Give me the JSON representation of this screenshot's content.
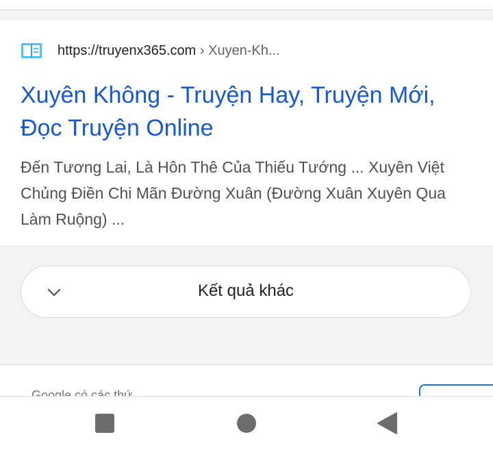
{
  "result": {
    "favicon_icon": "open-book-icon",
    "url_host": "https://truyenx365.com",
    "url_separator": " › ",
    "url_path": "Xuyen-Kh...",
    "title": "Xuyên Không - Truyện Hay, Truyện Mới, Đọc Truyện Online",
    "snippet": "Đến Tương Lai, Là Hôn Thê Của Thiếu Tướng ... Xuyên Việt Chủng Điền Chi Mãn Đường Xuân (Đường Xuân Xuyên Qua Làm Ruộng) ..."
  },
  "more_results": {
    "label": "Kết quả khác",
    "icon": "chevron-down-icon"
  },
  "footer": {
    "partial_text": "Google có các thứ"
  },
  "nav_bar": {
    "recents_icon": "square-icon",
    "home_icon": "circle-icon",
    "back_icon": "triangle-back-icon"
  },
  "colors": {
    "title_link": "#1558d6",
    "favicon": "#4fc3f7"
  }
}
